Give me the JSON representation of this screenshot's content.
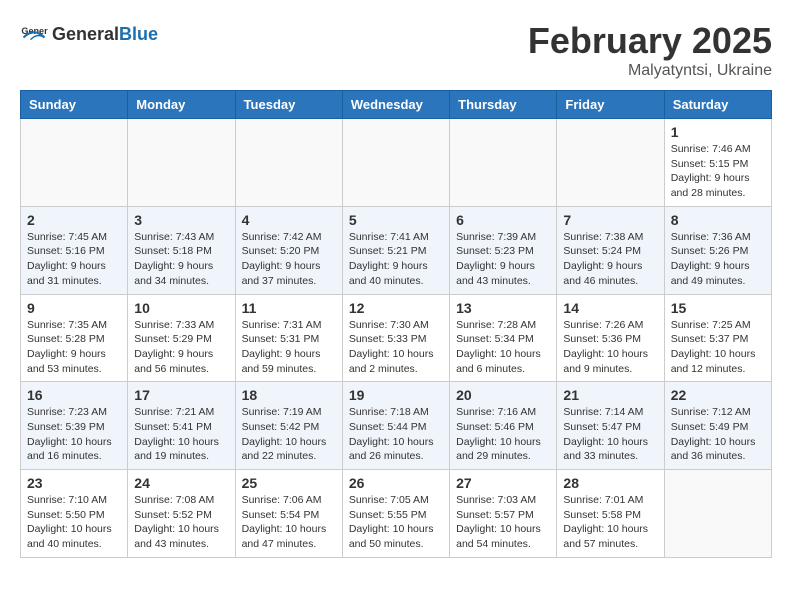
{
  "logo": {
    "general": "General",
    "blue": "Blue"
  },
  "header": {
    "month": "February 2025",
    "location": "Malyatyntsi, Ukraine"
  },
  "weekdays": [
    "Sunday",
    "Monday",
    "Tuesday",
    "Wednesday",
    "Thursday",
    "Friday",
    "Saturday"
  ],
  "weeks": [
    [
      {
        "day": "",
        "info": ""
      },
      {
        "day": "",
        "info": ""
      },
      {
        "day": "",
        "info": ""
      },
      {
        "day": "",
        "info": ""
      },
      {
        "day": "",
        "info": ""
      },
      {
        "day": "",
        "info": ""
      },
      {
        "day": "1",
        "info": "Sunrise: 7:46 AM\nSunset: 5:15 PM\nDaylight: 9 hours and 28 minutes."
      }
    ],
    [
      {
        "day": "2",
        "info": "Sunrise: 7:45 AM\nSunset: 5:16 PM\nDaylight: 9 hours and 31 minutes."
      },
      {
        "day": "3",
        "info": "Sunrise: 7:43 AM\nSunset: 5:18 PM\nDaylight: 9 hours and 34 minutes."
      },
      {
        "day": "4",
        "info": "Sunrise: 7:42 AM\nSunset: 5:20 PM\nDaylight: 9 hours and 37 minutes."
      },
      {
        "day": "5",
        "info": "Sunrise: 7:41 AM\nSunset: 5:21 PM\nDaylight: 9 hours and 40 minutes."
      },
      {
        "day": "6",
        "info": "Sunrise: 7:39 AM\nSunset: 5:23 PM\nDaylight: 9 hours and 43 minutes."
      },
      {
        "day": "7",
        "info": "Sunrise: 7:38 AM\nSunset: 5:24 PM\nDaylight: 9 hours and 46 minutes."
      },
      {
        "day": "8",
        "info": "Sunrise: 7:36 AM\nSunset: 5:26 PM\nDaylight: 9 hours and 49 minutes."
      }
    ],
    [
      {
        "day": "9",
        "info": "Sunrise: 7:35 AM\nSunset: 5:28 PM\nDaylight: 9 hours and 53 minutes."
      },
      {
        "day": "10",
        "info": "Sunrise: 7:33 AM\nSunset: 5:29 PM\nDaylight: 9 hours and 56 minutes."
      },
      {
        "day": "11",
        "info": "Sunrise: 7:31 AM\nSunset: 5:31 PM\nDaylight: 9 hours and 59 minutes."
      },
      {
        "day": "12",
        "info": "Sunrise: 7:30 AM\nSunset: 5:33 PM\nDaylight: 10 hours and 2 minutes."
      },
      {
        "day": "13",
        "info": "Sunrise: 7:28 AM\nSunset: 5:34 PM\nDaylight: 10 hours and 6 minutes."
      },
      {
        "day": "14",
        "info": "Sunrise: 7:26 AM\nSunset: 5:36 PM\nDaylight: 10 hours and 9 minutes."
      },
      {
        "day": "15",
        "info": "Sunrise: 7:25 AM\nSunset: 5:37 PM\nDaylight: 10 hours and 12 minutes."
      }
    ],
    [
      {
        "day": "16",
        "info": "Sunrise: 7:23 AM\nSunset: 5:39 PM\nDaylight: 10 hours and 16 minutes."
      },
      {
        "day": "17",
        "info": "Sunrise: 7:21 AM\nSunset: 5:41 PM\nDaylight: 10 hours and 19 minutes."
      },
      {
        "day": "18",
        "info": "Sunrise: 7:19 AM\nSunset: 5:42 PM\nDaylight: 10 hours and 22 minutes."
      },
      {
        "day": "19",
        "info": "Sunrise: 7:18 AM\nSunset: 5:44 PM\nDaylight: 10 hours and 26 minutes."
      },
      {
        "day": "20",
        "info": "Sunrise: 7:16 AM\nSunset: 5:46 PM\nDaylight: 10 hours and 29 minutes."
      },
      {
        "day": "21",
        "info": "Sunrise: 7:14 AM\nSunset: 5:47 PM\nDaylight: 10 hours and 33 minutes."
      },
      {
        "day": "22",
        "info": "Sunrise: 7:12 AM\nSunset: 5:49 PM\nDaylight: 10 hours and 36 minutes."
      }
    ],
    [
      {
        "day": "23",
        "info": "Sunrise: 7:10 AM\nSunset: 5:50 PM\nDaylight: 10 hours and 40 minutes."
      },
      {
        "day": "24",
        "info": "Sunrise: 7:08 AM\nSunset: 5:52 PM\nDaylight: 10 hours and 43 minutes."
      },
      {
        "day": "25",
        "info": "Sunrise: 7:06 AM\nSunset: 5:54 PM\nDaylight: 10 hours and 47 minutes."
      },
      {
        "day": "26",
        "info": "Sunrise: 7:05 AM\nSunset: 5:55 PM\nDaylight: 10 hours and 50 minutes."
      },
      {
        "day": "27",
        "info": "Sunrise: 7:03 AM\nSunset: 5:57 PM\nDaylight: 10 hours and 54 minutes."
      },
      {
        "day": "28",
        "info": "Sunrise: 7:01 AM\nSunset: 5:58 PM\nDaylight: 10 hours and 57 minutes."
      },
      {
        "day": "",
        "info": ""
      }
    ]
  ]
}
